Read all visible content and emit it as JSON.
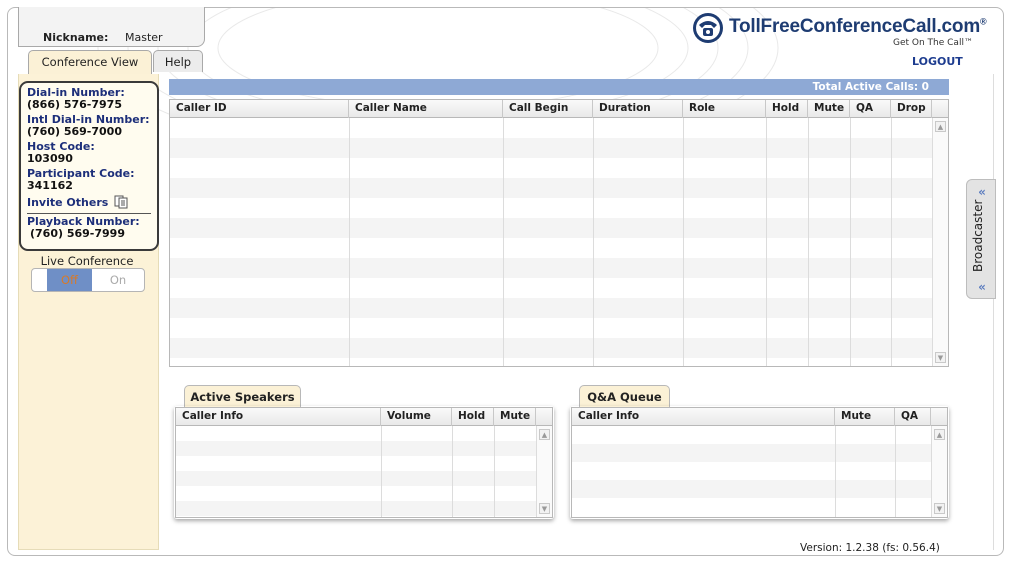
{
  "header": {
    "nickname_label": "Nickname:",
    "nickname_value": "Master",
    "brand": "TollFreeConferenceCall.com",
    "brand_mark": "®",
    "tagline": "Get On The Call™",
    "logout": "LOGOUT"
  },
  "tabs": [
    {
      "label": "Conference View",
      "active": true
    },
    {
      "label": "Help",
      "active": false
    }
  ],
  "info": {
    "dialin_label": "Dial-in Number:",
    "dialin_value": "(866) 576-7975",
    "intl_label": "Intl Dial-in Number:",
    "intl_value": "(760) 569-7000",
    "host_label": "Host Code:",
    "host_value": "103090",
    "participant_label": "Participant Code:",
    "participant_value": "341162",
    "invite_label": "Invite Others",
    "playback_label": "Playback Number:",
    "playback_value": "(760) 569-7999"
  },
  "live_conference": {
    "label": "Live Conference",
    "off": "Off",
    "on": "On",
    "state": "Off"
  },
  "calls": {
    "total_label": "Total Active Calls: 0",
    "columns": [
      "Caller ID",
      "Caller Name",
      "Call Begin",
      "Duration",
      "Role",
      "Hold",
      "Mute",
      "QA",
      "Drop"
    ],
    "rows": []
  },
  "speakers": {
    "tab_label": "Active Speakers",
    "columns": [
      "Caller Info",
      "Volume",
      "Hold",
      "Mute"
    ],
    "rows": []
  },
  "qa": {
    "tab_label": "Q&A Queue",
    "columns": [
      "Caller Info",
      "Mute",
      "QA"
    ],
    "rows": []
  },
  "broadcaster": {
    "label": "Broadcaster"
  },
  "footer": {
    "version": "Version: 1.2.38 (fs: 0.56.4)"
  },
  "colors": {
    "accent": "#8ea9d5",
    "panel": "#fcf2d7",
    "brand": "#1e3c72"
  }
}
